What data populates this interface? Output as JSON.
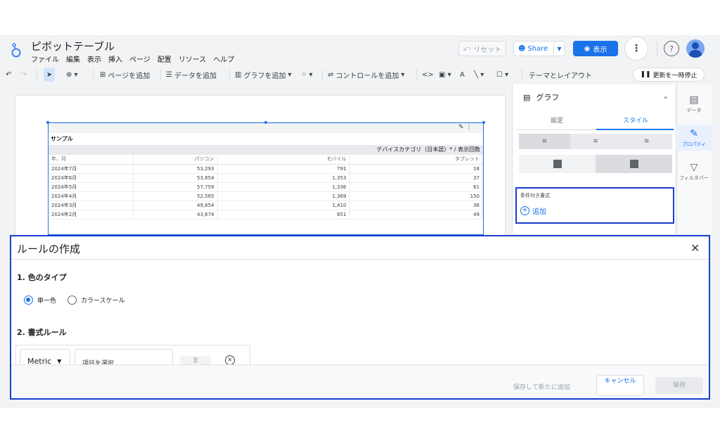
{
  "app": {
    "title": "ピボットテーブル",
    "menu": [
      "ファイル",
      "編集",
      "表示",
      "挿入",
      "ページ",
      "配置",
      "リソース",
      "ヘルプ"
    ],
    "reset_label": "リセット",
    "share_label": "Share",
    "view_label": "表示"
  },
  "toolbar": {
    "add_page": "ページを追加",
    "add_data": "データを追加",
    "add_chart": "グラフを追加",
    "add_control": "コントロールを追加",
    "theme_layout": "テーマとレイアウト",
    "pause_updates": "更新を一時停止"
  },
  "table": {
    "title": "サンプル",
    "group_header": "デバイスカテゴリ（日本語）* / 表示回数",
    "columns": [
      "年、月",
      "パソコン",
      "モバイル",
      "タブレット"
    ],
    "rows": [
      [
        "2024年7月",
        "53,293",
        "791",
        "18"
      ],
      [
        "2024年6月",
        "53,854",
        "1,353",
        "37"
      ],
      [
        "2024年5月",
        "57,759",
        "1,336",
        "61"
      ],
      [
        "2024年4月",
        "52,565",
        "1,369",
        "150"
      ],
      [
        "2024年3月",
        "49,854",
        "1,410",
        "36"
      ],
      [
        "2024年2月",
        "43,674",
        "851",
        "49"
      ]
    ]
  },
  "props": {
    "chart_label": "グラフ",
    "tab_setup": "設定",
    "tab_style": "スタイル",
    "conditional_format": "条件付き書式",
    "add_label": "追加"
  },
  "rail": {
    "data": "データ",
    "properties": "プロパティ",
    "filter": "フィルタバー"
  },
  "dialog": {
    "title": "ルールの作成",
    "section1": "1. 色のタイプ",
    "single_color": "単一色",
    "color_scale": "カラースケール",
    "section2": "2. 書式ルール",
    "metric": "Metric",
    "item_placeholder": "項目を選択",
    "operator": "ま",
    "save_and_add": "保存して新たに追加",
    "cancel": "キャンセル",
    "save": "保存"
  },
  "colors": {
    "accent": "#1a73e8",
    "highlight_border": "#1a3ecf"
  }
}
